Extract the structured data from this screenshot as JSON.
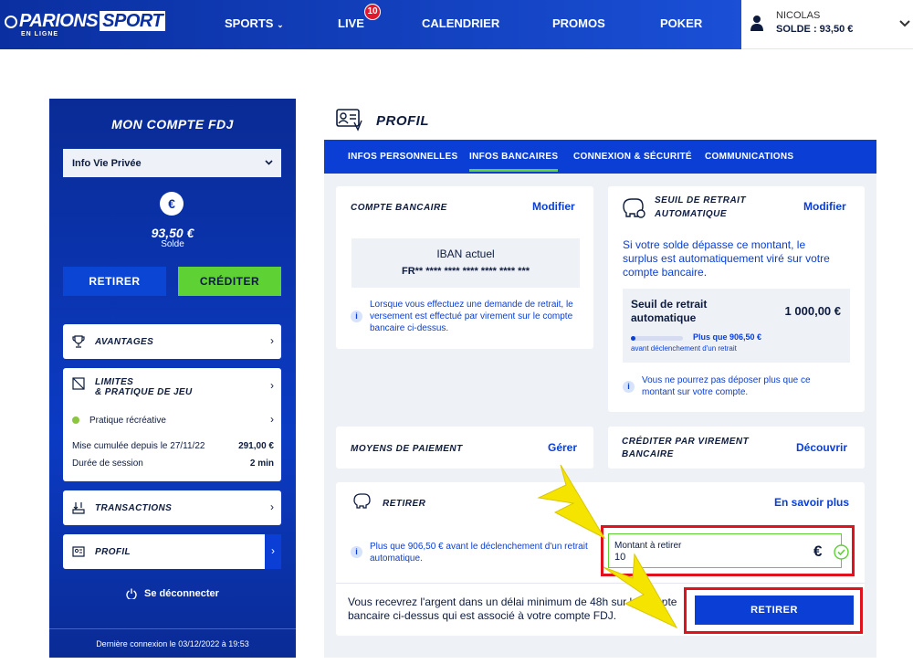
{
  "header": {
    "logo_main": "PARIONS",
    "logo_sport": "SPORT",
    "logo_sub": "EN LIGNE",
    "nav": [
      "SPORTS",
      "LIVE",
      "CALENDRIER",
      "PROMOS",
      "POKER"
    ],
    "sports_chevron": "⌄",
    "live_badge": "10",
    "user_name": "NICOLAS",
    "user_balance": "SOLDE : 93,50 €"
  },
  "sidebar": {
    "title": "MON COMPTE FDJ",
    "select_value": "Info Vie Privée",
    "currency_symbol": "€",
    "balance": "93,50 €",
    "balance_label": "Solde",
    "retirer_label": "RETIRER",
    "crediter_label": "CRÉDITER",
    "avantages": "AVANTAGES",
    "limites_line1": "LIMITES",
    "limites_line2": "& PRATIQUE DE JEU",
    "pratique": "Pratique récréative",
    "mise_label": "Mise cumulée depuis le 27/11/22",
    "mise_value": "291,00 €",
    "duree_label": "Durée de session",
    "duree_value": "2 min",
    "transactions": "TRANSACTIONS",
    "profil": "PROFIL",
    "logout": "Se déconnecter",
    "last_login": "Dernière connexion le 03/12/2022 à 19:53"
  },
  "main": {
    "title": "PROFIL",
    "tabs": [
      "INFOS PERSONNELLES",
      "INFOS BANCAIRES",
      "CONNEXION & SÉCURITÉ",
      "COMMUNICATIONS"
    ],
    "compte": {
      "title": "COMPTE BANCAIRE",
      "link": "Modifier",
      "iban_label": "IBAN actuel",
      "iban_value": "FR** **** **** **** **** **** ***",
      "info": "Lorsque vous effectuez une demande de retrait, le versement est effectué par virement sur le compte bancaire ci-dessus."
    },
    "seuil": {
      "title_line1": "SEUIL DE RETRAIT",
      "title_line2": "AUTOMATIQUE",
      "link": "Modifier",
      "desc": "Si votre solde dépasse ce montant, le surplus est automatiquement viré sur votre compte bancaire.",
      "box_label": "Seuil de retrait automatique",
      "box_value": "1 000,00 €",
      "progress_fraction": 0.093,
      "progress_text": "Plus que 906,50 €",
      "progress_sub": "avant déclenchement d'un retrait",
      "info": "Vous ne pourrez pas déposer plus que ce montant sur votre compte."
    },
    "moyens": {
      "title": "MOYENS DE PAIEMENT",
      "link": "Gérer"
    },
    "virement": {
      "title_line1": "CRÉDITER PAR VIREMENT",
      "title_line2": "BANCAIRE",
      "link": "Découvrir"
    },
    "retirer": {
      "title": "RETIRER",
      "link": "En savoir plus",
      "info": "Plus que 906,50 € avant le déclenchement d'un retrait automatique.",
      "field_label": "Montant à retirer",
      "field_value": "10",
      "field_currency": "€",
      "note": "Vous recevrez l'argent dans un délai minimum de 48h sur le compte bancaire ci-dessus qui est associé à votre compte FDJ.",
      "button": "RETIRER"
    }
  },
  "colors": {
    "brand_blue": "#0a3ed4",
    "green": "#5ed134",
    "highlight_red": "#e0121e",
    "arrow_yellow": "#f5e400"
  }
}
